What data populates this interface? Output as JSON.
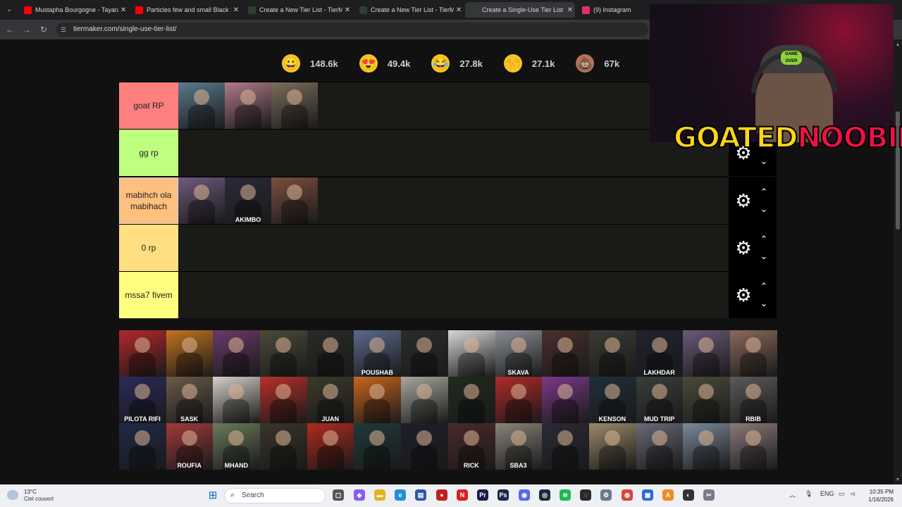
{
  "browser": {
    "tabs": [
      {
        "title": "Mustapha Bourgogne - Tayara",
        "favicon_color": "#ff0000",
        "active": false
      },
      {
        "title": "Particles few and small Black S",
        "favicon_color": "#ff0000",
        "active": false
      },
      {
        "title": "Create a New Tier List - TierMa",
        "favicon_color": "#2f3f2f",
        "active": false
      },
      {
        "title": "Create a New Tier List - TierMa",
        "favicon_color": "#2f3f2f",
        "active": false
      },
      {
        "title": "Create a Single-Use Tier List (P",
        "favicon_color": "#2f3f2f",
        "active": true
      },
      {
        "title": "(9) Instagram",
        "favicon_color": "#e1306c",
        "active": false
      }
    ],
    "url": "tiermaker.com/single-use-tier-list/"
  },
  "reactions": [
    {
      "icon": "grinning-face-icon",
      "count": "148.6k",
      "color": "#f7c521"
    },
    {
      "icon": "heart-eyes-face-icon",
      "count": "49.4k",
      "color": "#f7c521"
    },
    {
      "icon": "laughing-face-icon",
      "count": "27.8k",
      "color": "#f7c521"
    },
    {
      "icon": "raised-hands-icon",
      "count": "27.1k",
      "color": "#f7c521"
    },
    {
      "icon": "poop-icon",
      "count": "67k",
      "color": "#b0765a"
    }
  ],
  "tiers": [
    {
      "label": "goat RP",
      "color": "#ff7f7f",
      "items": 3
    },
    {
      "label": "gg rp",
      "color": "#bfff7f",
      "items": 0
    },
    {
      "label": "mabihch ola mabihach",
      "color": "#ffbf7f",
      "items": 3
    },
    {
      "label": "0 rp",
      "color": "#ffdf7f",
      "items": 0
    },
    {
      "label": "mssa7 fivem",
      "color": "#ffff7f",
      "items": 0
    }
  ],
  "tier_items": {
    "goat": [
      {
        "caption": "",
        "color": "#5b7a8c"
      },
      {
        "caption": "",
        "color": "#b07a8a"
      },
      {
        "caption": "",
        "color": "#7a6d5b"
      }
    ],
    "mabihch": [
      {
        "caption": "",
        "color": "#6e5a7e"
      },
      {
        "caption": "AKIMBO",
        "color": "#2a2a3a"
      },
      {
        "caption": "",
        "color": "#7a4f3f"
      }
    ]
  },
  "pool": [
    {
      "caption": "",
      "color": "#b3282a"
    },
    {
      "caption": "",
      "color": "#c2741f"
    },
    {
      "caption": "",
      "color": "#6a3a6a"
    },
    {
      "caption": "",
      "color": "#4a4a3a"
    },
    {
      "caption": "",
      "color": "#2a2a28"
    },
    {
      "caption": "POUSHAB",
      "color": "#5a6a8a"
    },
    {
      "caption": "",
      "color": "#2a2d2a"
    },
    {
      "caption": "",
      "color": "#d8d8d8"
    },
    {
      "caption": "SKAVA",
      "color": "#8a8f95"
    },
    {
      "caption": "",
      "color": "#4a2f2f"
    },
    {
      "caption": "",
      "color": "#3a3a35"
    },
    {
      "caption": "LAKHDAR",
      "color": "#1f2230"
    },
    {
      "caption": "",
      "color": "#6a5a7a"
    },
    {
      "caption": "",
      "color": "#8a6a5a"
    },
    {
      "caption": "PILOTA RIFI",
      "color": "#2a2a5a"
    },
    {
      "caption": "SASK",
      "color": "#6a5a4a"
    },
    {
      "caption": "",
      "color": "#d5d0c8"
    },
    {
      "caption": "",
      "color": "#b8302a"
    },
    {
      "caption": "JUAN",
      "color": "#3a3a2a"
    },
    {
      "caption": "",
      "color": "#c9661f"
    },
    {
      "caption": "",
      "color": "#a8a8a0"
    },
    {
      "caption": "",
      "color": "#1f2a1f"
    },
    {
      "caption": "",
      "color": "#b02a2a"
    },
    {
      "caption": "",
      "color": "#7a3a8a"
    },
    {
      "caption": "KENSON",
      "color": "#1f2f3a"
    },
    {
      "caption": "MUD TRIP",
      "color": "#3a3f3a"
    },
    {
      "caption": "",
      "color": "#4a4a3a"
    },
    {
      "caption": "RBIB",
      "color": "#5a5a5a"
    },
    {
      "caption": "",
      "color": "#1f2a4a"
    },
    {
      "caption": "ROUFIA",
      "color": "#a03a3a"
    },
    {
      "caption": "MHAND",
      "color": "#6a7a5a"
    },
    {
      "caption": "",
      "color": "#3a352a"
    },
    {
      "caption": "",
      "color": "#b02a1f"
    },
    {
      "caption": "",
      "color": "#1f3a3a"
    },
    {
      "caption": "",
      "color": "#1f1f2a"
    },
    {
      "caption": "RICK",
      "color": "#4a2a2a"
    },
    {
      "caption": "SBA3",
      "color": "#8a857a"
    },
    {
      "caption": "",
      "color": "#2a2a35"
    },
    {
      "caption": "",
      "color": "#9a8a6a"
    },
    {
      "caption": "",
      "color": "#6a6a7a"
    },
    {
      "caption": "",
      "color": "#7a8a9a"
    },
    {
      "caption": "",
      "color": "#8a7a7a"
    }
  ],
  "overlay": {
    "logo_part1": "GOATED",
    "logo_part2": "NOOBIE",
    "cap_text": "GAME OVER"
  },
  "taskbar": {
    "temperature": "13°C",
    "weather": "Ciel couvert",
    "search_placeholder": "Search",
    "language": "ENG",
    "time": "10:35 PM",
    "date": "1/16/2026"
  }
}
